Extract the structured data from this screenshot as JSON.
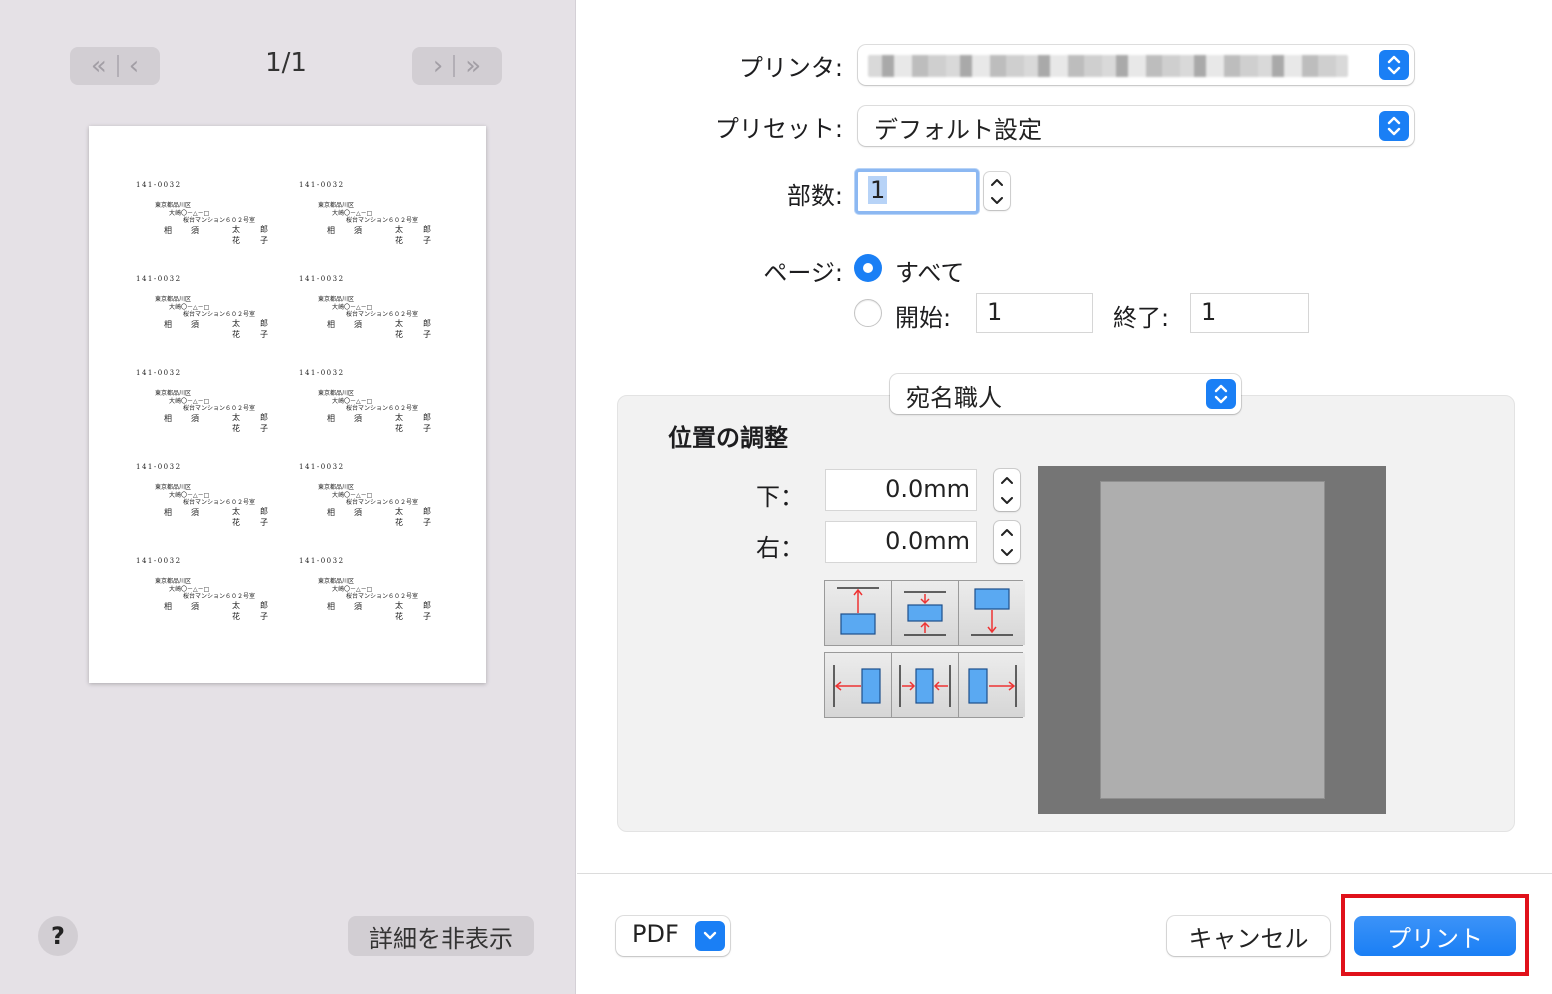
{
  "preview": {
    "page_indicator": "1/1",
    "label_text": {
      "zip": "141-0032",
      "address1": "東京都品川区",
      "address2": "大崎〇－△－□",
      "address3": "桜台マンション６０２号室",
      "family1": "相",
      "family2": "須",
      "given1": "太",
      "given2": "郎",
      "given3": "花",
      "given4": "子"
    },
    "hide_details_label": "詳細を非表示",
    "help_label": "?"
  },
  "form": {
    "printer_label": "プリンタ:",
    "preset_label": "プリセット:",
    "preset_value": "デフォルト設定",
    "copies_label": "部数:",
    "copies_value": "1",
    "pages_label": "ページ:",
    "pages_all_label": "すべて",
    "pages_from_label": "開始:",
    "pages_from_value": "1",
    "pages_to_label": "終了:",
    "pages_to_value": "1"
  },
  "app_section": {
    "selector_value": "宛名職人",
    "group_title": "位置の調整",
    "bottom_label": "下：",
    "bottom_value": "0.0mm",
    "right_label": "右：",
    "right_value": "0.0mm"
  },
  "footer": {
    "pdf_label": "PDF",
    "cancel_label": "キャンセル",
    "print_label": "プリント"
  },
  "colors": {
    "accent": "#1a7ff5",
    "highlight": "#e0111a",
    "sidebar_bg": "#e5e1e6"
  }
}
